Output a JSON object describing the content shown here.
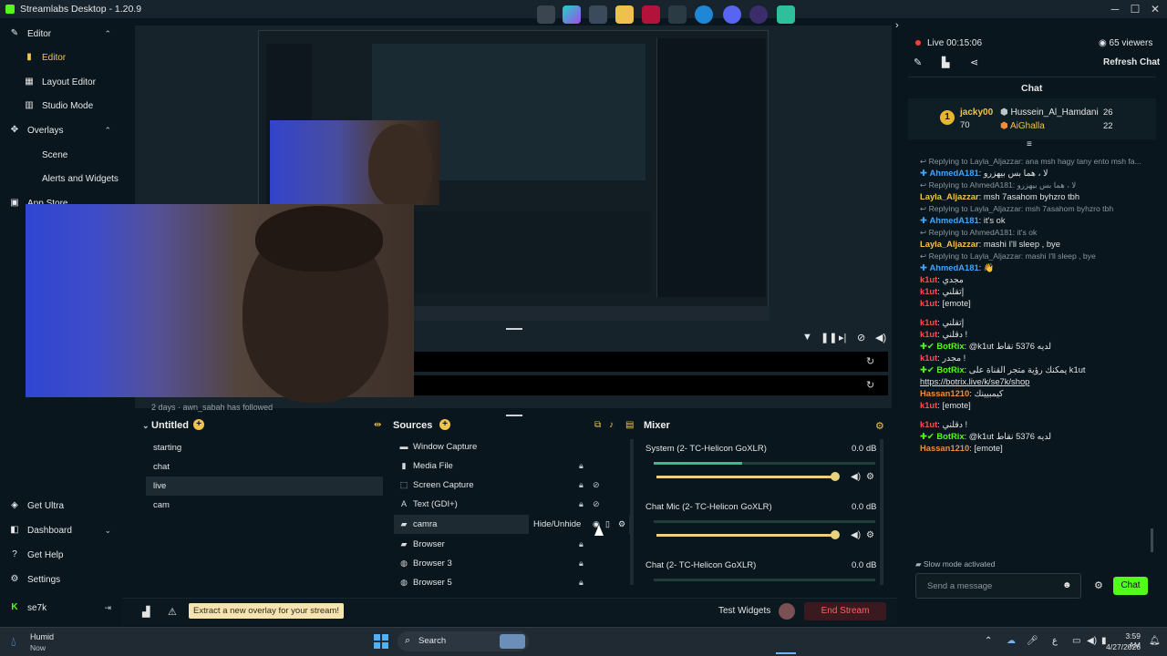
{
  "app": {
    "title": "Streamlabs Desktop - 1.20.9"
  },
  "sidebar": {
    "sections": [
      {
        "label": "Editor",
        "icon": "brush-icon",
        "expanded": true
      },
      {
        "label": "Editor",
        "icon": "lock-icon",
        "active": true
      },
      {
        "label": "Layout Editor",
        "icon": "grid-icon"
      },
      {
        "label": "Studio Mode",
        "icon": "columns-icon"
      },
      {
        "label": "Overlays",
        "icon": "palette-icon",
        "expanded": true
      },
      {
        "label": "Scene",
        "icon": ""
      },
      {
        "label": "Alerts and Widgets",
        "icon": ""
      },
      {
        "label": "App Store",
        "icon": "store-icon",
        "expanded": true
      }
    ],
    "bottom": [
      {
        "label": "Get Ultra",
        "icon": "ultra-icon"
      },
      {
        "label": "Dashboard",
        "icon": "dashboard-icon"
      },
      {
        "label": "Get Help",
        "icon": "help-icon"
      },
      {
        "label": "Settings",
        "icon": "gear-icon"
      },
      {
        "label": "se7k",
        "icon": "kick-icon"
      }
    ]
  },
  "preview": {
    "follow_text": "2 days  ·  awn_sabah  has followed"
  },
  "scenes": {
    "title": "Untitled",
    "items": [
      "starting",
      "chat",
      "live",
      "cam"
    ],
    "selected": "live"
  },
  "sources": {
    "title": "Sources",
    "items": [
      {
        "name": "Window Capture",
        "icon": "window-icon"
      },
      {
        "name": "Media File",
        "icon": "media-icon"
      },
      {
        "name": "Screen Capture",
        "icon": "screen-icon"
      },
      {
        "name": "Text (GDI+)",
        "icon": "text-icon"
      },
      {
        "name": "camra",
        "icon": "folder-icon"
      },
      {
        "name": "Browser",
        "icon": "folder-icon"
      },
      {
        "name": "Browser 3",
        "icon": "globe-icon"
      },
      {
        "name": "Browser 5",
        "icon": "globe-icon"
      }
    ],
    "tooltip": "Hide/Unhide"
  },
  "mixer": {
    "title": "Mixer",
    "channels": [
      {
        "name": "System (2- TC-Helicon GoXLR)",
        "db": "0.0 dB",
        "level": 0.4
      },
      {
        "name": "Chat Mic (2- TC-Helicon GoXLR)",
        "db": "0.0 dB",
        "level": 0.0
      },
      {
        "name": "Chat (2- TC-Helicon GoXLR)",
        "db": "0.0 dB",
        "level": 0.0
      }
    ]
  },
  "footer": {
    "hint": "Extract a new overlay for your stream!",
    "test_widgets": "Test Widgets",
    "end_stream": "End Stream"
  },
  "stream": {
    "live_label": "Live 00:15:06",
    "viewers": "65 viewers",
    "refresh": "Refresh Chat",
    "chat_title": "Chat"
  },
  "leaderboard": [
    {
      "rank": "1",
      "name": "jacky00",
      "amount": "70"
    },
    {
      "name": "Hussein_Al_Hamdani",
      "amount": "26"
    },
    {
      "name": "AiGhalla",
      "amount": "22"
    }
  ],
  "chat_messages": [
    {
      "reply": "Replying to Layla_Aljazzar: ana msh hagy tany ento msh fa..."
    },
    {
      "user": "AhmedA181",
      "color": "#3ea6ff",
      "text": "لا ، هما بس بيهزرو",
      "badge": "kick"
    },
    {
      "reply": "Replying to AhmedA181: لا ، هما بس بيهزرو"
    },
    {
      "user": "Layla_Aljazzar",
      "color": "#f1c44d",
      "text": "msh 7asahom byhzro tbh"
    },
    {
      "reply": "Replying to Layla_Aljazzar: msh 7asahom byhzro tbh"
    },
    {
      "user": "AhmedA181",
      "color": "#3ea6ff",
      "text": "it's ok",
      "badge": "kick"
    },
    {
      "reply": "Replying to AhmedA181: it's ok"
    },
    {
      "user": "Layla_Aljazzar",
      "color": "#f1c44d",
      "text": "mashi I'll sleep , bye"
    },
    {
      "reply": "Replying to Layla_Aljazzar: mashi I'll sleep , bye"
    },
    {
      "user": "AhmedA181",
      "color": "#3ea6ff",
      "text": "👋",
      "badge": "kick"
    },
    {
      "user": "k1ut",
      "color": "#ff4d4d",
      "text": "مجدي"
    },
    {
      "user": "k1ut",
      "color": "#ff4d4d",
      "text": "إتقلني"
    },
    {
      "user": "k1ut",
      "color": "#ff4d4d",
      "text": "[emote]"
    },
    {
      "user": "k1ut",
      "color": "#ff4d4d",
      "text": "إتقلني"
    },
    {
      "user": "k1ut",
      "color": "#ff4d4d",
      "text": "دقلني !"
    },
    {
      "user": "BotRix",
      "color": "#53fc18",
      "text": "@k1ut لديه 5376 نقاط",
      "badge": "bot"
    },
    {
      "user": "k1ut",
      "color": "#ff4d4d",
      "text": "مجدر !"
    },
    {
      "user": "BotRix",
      "color": "#53fc18",
      "text": "يمكنك رؤية متجر القناة على k1ut",
      "badge": "bot"
    },
    {
      "link": "https://botrix.live/k/se7k/shop"
    },
    {
      "user": "Hassan1210",
      "color": "#f08c3c",
      "text": "كيمبيينك"
    },
    {
      "user": "k1ut",
      "color": "#ff4d4d",
      "text": "[emote]"
    },
    {
      "user": "k1ut",
      "color": "#ff4d4d",
      "text": "دقلني !"
    },
    {
      "user": "BotRix",
      "color": "#53fc18",
      "text": "@k1ut لديه 5376 نقاط",
      "badge": "bot"
    },
    {
      "user": "Hassan1210",
      "color": "#f08c3c",
      "text": "[emote]"
    }
  ],
  "chat_footer": {
    "slow_mode": "Slow mode activated",
    "placeholder": "Send a message",
    "send": "Chat"
  },
  "taskbar": {
    "weather_temp": "Humid",
    "weather_sub": "Now",
    "search": "Search",
    "time": "3:59 AM",
    "date": "4/27/2026",
    "lang": "ع"
  },
  "colors": {
    "accent": "#53fc18",
    "live": "#ff3b3b",
    "scene_bg": "#1d2a32"
  }
}
